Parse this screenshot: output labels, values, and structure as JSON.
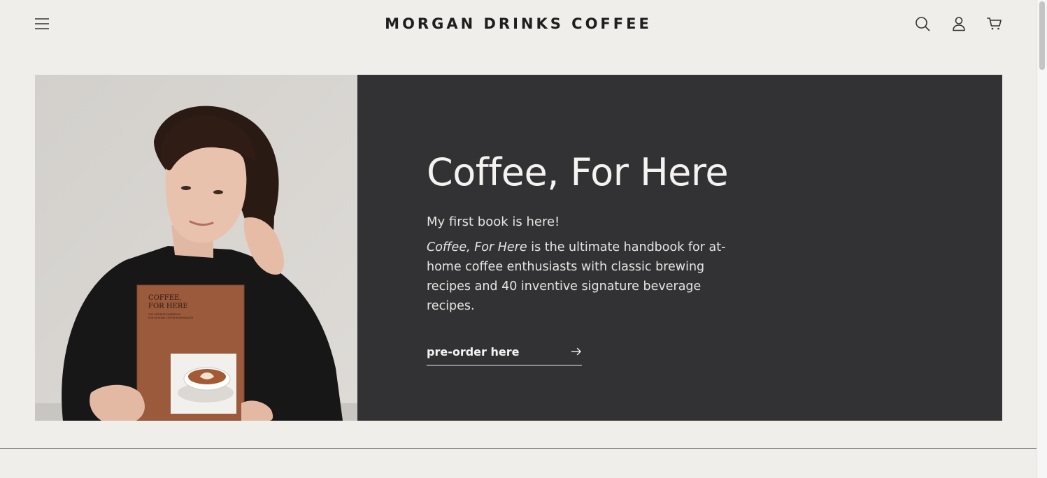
{
  "header": {
    "logo": "MORGAN DRINKS COFFEE",
    "menu_icon": "hamburger-menu-icon",
    "search_icon": "search-icon",
    "account_icon": "user-icon",
    "cart_icon": "cart-icon"
  },
  "banner": {
    "headline": "Coffee, For Here",
    "subhead": "My first book is here!",
    "desc_italic": "Coffee, For Here",
    "desc_rest": " is the ultimate handbook for at-home coffee enthusiasts with classic brewing recipes and 40 inventive signature beverage recipes.",
    "cta_label": "pre-order here",
    "cta_icon": "arrow-right-icon",
    "book": {
      "title_line1": "COFFEE,",
      "title_line2": "FOR HERE",
      "tagline_line1": "THE ULTIMATE HANDBOOK",
      "tagline_line2": "FOR AT-HOME COFFEE ENTHUSIASTS"
    }
  },
  "colors": {
    "background": "#efeeeb",
    "banner_dark": "#323234",
    "text_light": "#f4f3f0",
    "book_cover": "#9a5a3c"
  }
}
